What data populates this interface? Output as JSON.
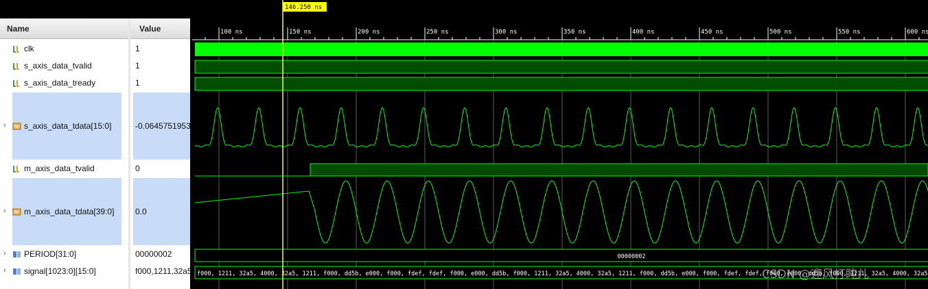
{
  "headers": {
    "name": "Name",
    "value": "Value"
  },
  "cursor": {
    "label": "146.250 ns"
  },
  "timeline": {
    "ticks": [
      "100 ns",
      "150 ns",
      "200 ns",
      "250 ns",
      "300 ns",
      "350 ns",
      "400 ns",
      "450 ns",
      "500 ns",
      "550 ns",
      "600 ns"
    ]
  },
  "signals": [
    {
      "name": "clk",
      "value": "1",
      "type": "bit"
    },
    {
      "name": "s_axis_data_tvalid",
      "value": "1",
      "type": "bit"
    },
    {
      "name": "s_axis_data_tready",
      "value": "1",
      "type": "bit"
    },
    {
      "name": "s_axis_data_tdata[15:0]",
      "value": "-0.0645751953",
      "type": "bus-analog"
    },
    {
      "name": "m_axis_data_tvalid",
      "value": "0",
      "type": "bit"
    },
    {
      "name": "m_axis_data_tdata[39:0]",
      "value": "0.0",
      "type": "bus-analog"
    },
    {
      "name": "PERIOD[31:0]",
      "value": "00000002",
      "type": "bus"
    },
    {
      "name": "signal[1023:0][15:0]",
      "value": "f000,1211,32a5",
      "type": "bus-array"
    }
  ],
  "period_bus_text": "00000002",
  "signal_bus_text": "f000, 1211, 32a5, 4000, 32a5, 1211, f000, dd5b, e000, f000, fdef, fdef, f000, e000, dd5b, f000, 1211, 32a5, 4000, 32a5, 1211, f000, dd5b, e000, f000, fdef, fdef, f000, e000, dd5b, f000, 1211, 32a5, 4000, 32a5, 12",
  "watermark": "CSDN @迎风打盹儿",
  "colors": {
    "wave": "#00ff00",
    "cursor": "#ffff00",
    "grid": "#5a5a5a",
    "bitfill": "#004d00",
    "selection": "#c9dcf7"
  }
}
